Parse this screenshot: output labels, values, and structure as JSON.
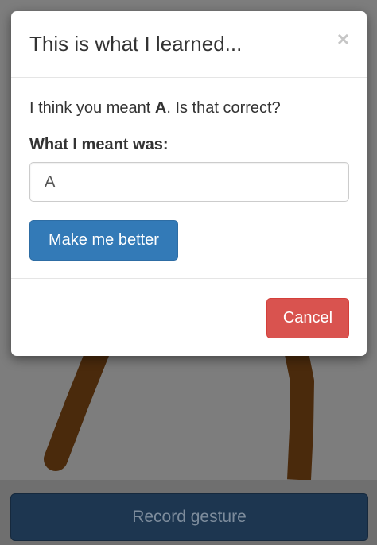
{
  "modal": {
    "title": "This is what I learned...",
    "close_icon": "×",
    "prompt_prefix": "I think you meant ",
    "guess": "A",
    "prompt_suffix": ". Is that correct?",
    "field_label": "What I meant was:",
    "input_value": "A",
    "improve_button": "Make me better",
    "cancel_button": "Cancel"
  },
  "toolbar": {
    "record_button": "Record gesture"
  },
  "colors": {
    "primary": "#337ab7",
    "danger": "#d9534f",
    "stroke": "#4a2a0c",
    "record_bg": "#1d3650"
  }
}
